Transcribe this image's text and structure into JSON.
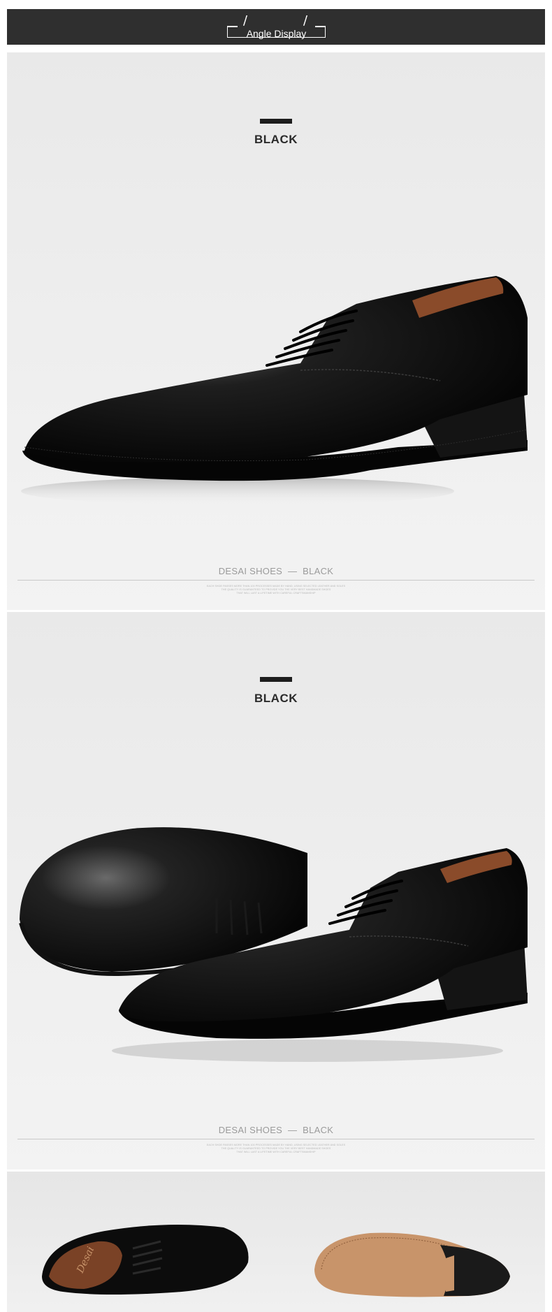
{
  "header": {
    "title": "Angle Display",
    "slash": "/"
  },
  "panels": [
    {
      "label": "BLACK",
      "caption_brand": "DESAI SHOES",
      "caption_dash": "—",
      "caption_color": "BLACK",
      "fine_print": [
        "EACH SHOE PASSES MORE THAN 100 PROCESSES MADE BY HAND, USING SELECTED LEATHER AND SOLES",
        "THE QUALITY IS GUARANTEED TO PROVIDE YOU THE VERY BEST HANDMADE SHOES",
        "THAT WILL LAST A LIFETIME WITH CAREFUL CRAFTSMANSHIP"
      ]
    },
    {
      "label": "BLACK",
      "caption_brand": "DESAI SHOES",
      "caption_dash": "—",
      "caption_color": "BLACK",
      "fine_print": [
        "EACH SHOE PASSES MORE THAN 100 PROCESSES MADE BY HAND, USING SELECTED LEATHER AND SOLES",
        "THE QUALITY IS GUARANTEED TO PROVIDE YOU THE VERY BEST HANDMADE SHOES",
        "THAT WILL LAST A LIFETIME WITH CAREFUL CRAFTSMANSHIP"
      ]
    }
  ],
  "bottom_panel": {
    "insole_brand": "Desai"
  },
  "colors": {
    "header_bg": "#2f2f2f",
    "leather": "#0e0e0e",
    "lining": "#8a4b2a",
    "sole_tan": "#c8946a"
  }
}
